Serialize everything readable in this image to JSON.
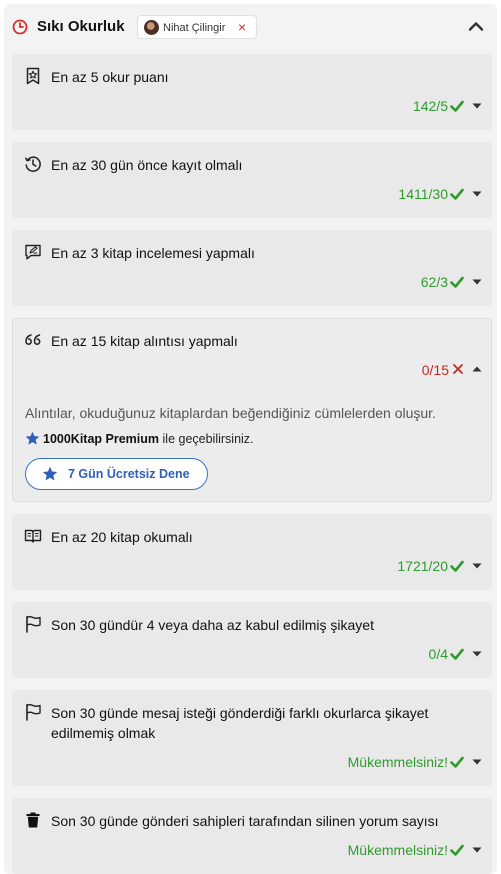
{
  "header": {
    "title": "Sıkı Okurluk",
    "user_chip": {
      "name": "Nihat Çilingir",
      "remove_symbol": "×"
    },
    "accent_color": "#d32f2f"
  },
  "criteria": [
    {
      "icon": "badge-star-icon",
      "title": "En az 5 okur puanı",
      "status": "142/5",
      "passed": true,
      "expanded": false
    },
    {
      "icon": "clock-history-icon",
      "title": "En az 30 gün önce kayıt olmalı",
      "status": "1411/30",
      "passed": true,
      "expanded": false
    },
    {
      "icon": "review-icon",
      "title": "En az 3 kitap incelemesi yapmalı",
      "status": "62/3",
      "passed": true,
      "expanded": false
    },
    {
      "icon": "quote-icon",
      "title": "En az 15 kitap alıntısı yapmalı",
      "status": "0/15",
      "passed": false,
      "expanded": true
    },
    {
      "icon": "book-open-icon",
      "title": "En az 20 kitap okumalı",
      "status": "1721/20",
      "passed": true,
      "expanded": false
    },
    {
      "icon": "flag-icon",
      "title": "Son 30 gündür 4 veya daha az kabul edilmiş şikayet",
      "status": "0/4",
      "passed": true,
      "expanded": false
    },
    {
      "icon": "flag-icon",
      "title": "Son 30 günde mesaj isteği gönderdiği farklı okurlarca şikayet edilmemiş olmak",
      "status": "Mükemmelsiniz!",
      "passed": true,
      "expanded": false
    },
    {
      "icon": "trash-icon",
      "title": "Son 30 günde gönderi sahipleri tarafından silinen yorum sayısı",
      "status": "Mükemmelsiniz!",
      "passed": true,
      "expanded": false
    }
  ],
  "expanded_detail": {
    "description": "Alıntılar, okuduğunuz kitaplardan beğendiğiniz cümlelerden oluşur.",
    "premium_name": "1000Kitap Premium",
    "premium_suffix": "ile geçebilirsiniz.",
    "trial_button": "7 Gün Ücretsiz Dene"
  },
  "colors": {
    "pass": "#2e9b2e",
    "fail": "#c62828",
    "premium_blue": "#2f5fb8"
  }
}
